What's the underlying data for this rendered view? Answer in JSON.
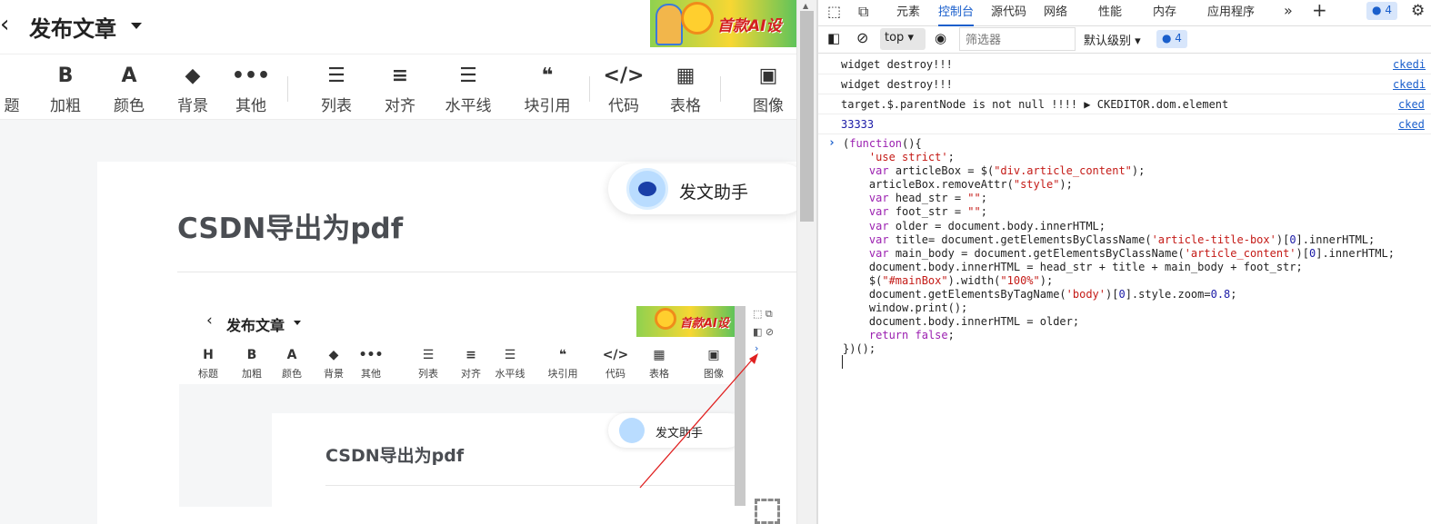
{
  "editor": {
    "page_title": "发布文章",
    "banner_text": "首款AI设",
    "toolbar": [
      {
        "icon": "heading-icon",
        "glyph": "",
        "label": "题"
      },
      {
        "icon": "bold-icon",
        "glyph": "B",
        "label": "加粗"
      },
      {
        "icon": "font-color-icon",
        "glyph": "A",
        "label": "颜色"
      },
      {
        "icon": "paint-bucket-icon",
        "glyph": "◆",
        "label": "背景"
      },
      {
        "icon": "more-icon",
        "glyph": "•••",
        "label": "其他"
      },
      {
        "icon": "list-icon",
        "glyph": "☰",
        "label": "列表"
      },
      {
        "icon": "align-icon",
        "glyph": "≡",
        "label": "对齐"
      },
      {
        "icon": "horizontal-line-icon",
        "glyph": "☰",
        "label": "水平线"
      },
      {
        "icon": "quote-icon",
        "glyph": "❝",
        "label": "块引用"
      },
      {
        "icon": "code-icon",
        "glyph": "</>",
        "label": "代码"
      },
      {
        "icon": "table-icon",
        "glyph": "▦",
        "label": "表格"
      },
      {
        "icon": "image-icon",
        "glyph": "▣",
        "label": "图像"
      }
    ],
    "article_title": "CSDN导出为pdf",
    "assistant_label": "发文助手",
    "nested": {
      "page_title": "发布文章",
      "banner_text": "首款AI设",
      "toolbar": [
        {
          "glyph": "H",
          "label": "标题"
        },
        {
          "glyph": "B",
          "label": "加粗"
        },
        {
          "glyph": "A",
          "label": "颜色"
        },
        {
          "glyph": "◆",
          "label": "背景"
        },
        {
          "glyph": "•••",
          "label": "其他"
        },
        {
          "glyph": "☰",
          "label": "列表"
        },
        {
          "glyph": "≡",
          "label": "对齐"
        },
        {
          "glyph": "☰",
          "label": "水平线"
        },
        {
          "glyph": "❝",
          "label": "块引用"
        },
        {
          "glyph": "</>",
          "label": "代码"
        },
        {
          "glyph": "▦",
          "label": "表格"
        },
        {
          "glyph": "▣",
          "label": "图像"
        }
      ],
      "article_title": "CSDN导出为pdf",
      "assistant_label": "发文助手"
    }
  },
  "devtools": {
    "tabs": [
      "元素",
      "控制台",
      "源代码",
      "网络",
      "性能",
      "内存",
      "应用程序"
    ],
    "active_tab": "控制台",
    "issues_count": "4",
    "context": "top",
    "filter_placeholder": "筛选器",
    "level": "默认级别",
    "logs": [
      {
        "msg": "widget destroy!!!",
        "src": "ckedi"
      },
      {
        "msg": "widget destroy!!!",
        "src": "ckedi"
      },
      {
        "msg": "target.$.parentNode is not null !!!!  ▶ CKEDITOR.dom.element",
        "src": "cked"
      },
      {
        "msg": "33333",
        "src": "cked"
      }
    ],
    "code_lines": [
      "(function(){",
      "    'use strict';",
      "    var articleBox = $(\"div.article_content\");",
      "    articleBox.removeAttr(\"style\");",
      "    var head_str = \"\";",
      "    var foot_str = \"\";",
      "    var older = document.body.innerHTML;",
      "    var title= document.getElementsByClassName('article-title-box')[0].innerHTML;",
      "    var main_body = document.getElementsByClassName('article_content')[0].innerHTML;",
      "    document.body.innerHTML = head_str + title + main_body + foot_str;",
      "    $(\"#mainBox\").width(\"100%\");",
      "    document.getElementsByTagName('body')[0].style.zoom=0.8;",
      "    window.print();",
      "    document.body.innerHTML = older;",
      "    return false;",
      "})();"
    ]
  }
}
